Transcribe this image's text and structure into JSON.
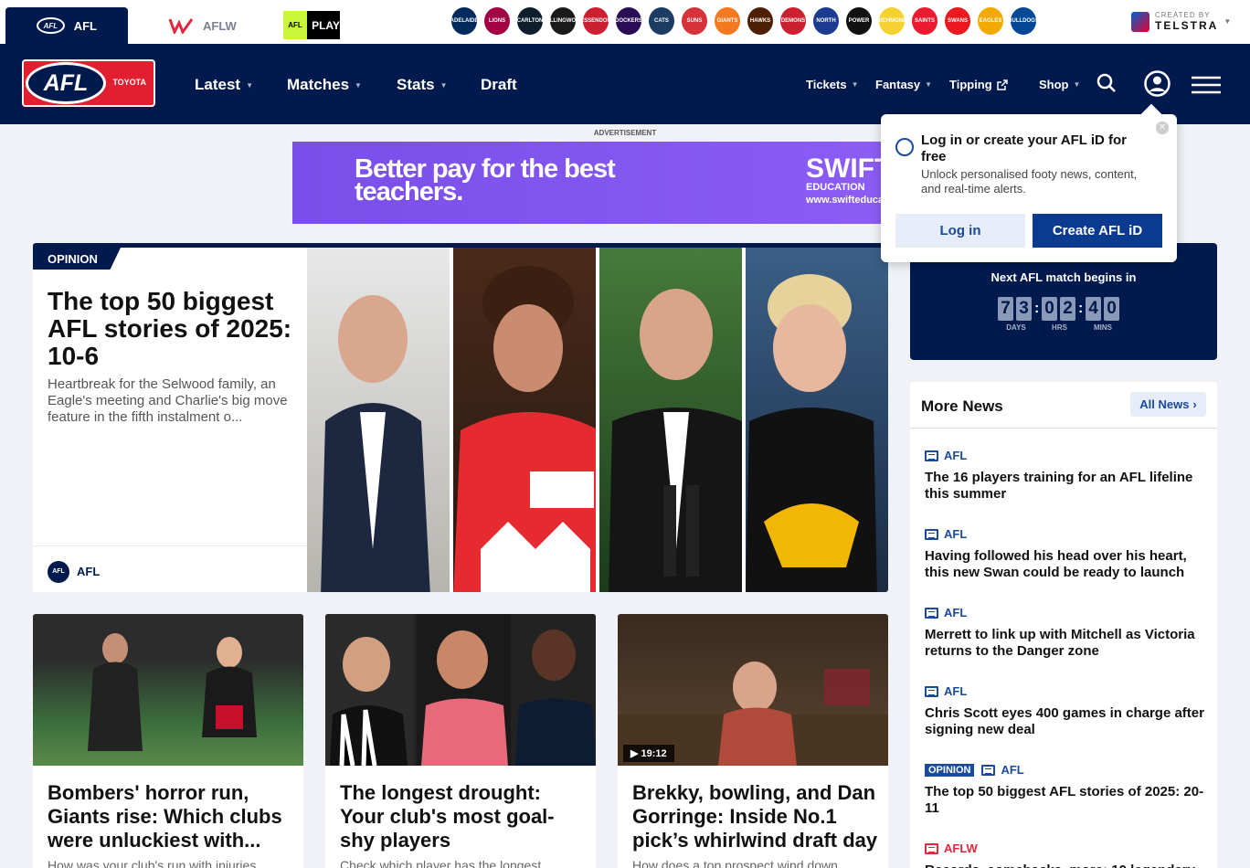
{
  "top_tabs": {
    "afl": "AFL",
    "aflw": "AFLW",
    "afl_mini": "AFL",
    "play": "PLAY"
  },
  "clubs": [
    {
      "name": "ADELAIDE",
      "color": "#002b5c"
    },
    {
      "name": "LIONS",
      "color": "#a30046"
    },
    {
      "name": "CARLTON",
      "color": "#0e1e2d"
    },
    {
      "name": "COLLINGWOOD",
      "color": "#1a1a1a"
    },
    {
      "name": "ESSENDON",
      "color": "#cc2031"
    },
    {
      "name": "DOCKERS",
      "color": "#2a0d54"
    },
    {
      "name": "CATS",
      "color": "#1c3c63"
    },
    {
      "name": "SUNS",
      "color": "#d63239"
    },
    {
      "name": "GIANTS",
      "color": "#f47920"
    },
    {
      "name": "HAWKS",
      "color": "#4d2004"
    },
    {
      "name": "DEMONS",
      "color": "#cc2031"
    },
    {
      "name": "NORTH",
      "color": "#1a3b8f"
    },
    {
      "name": "POWER",
      "color": "#111111"
    },
    {
      "name": "RICHMOND",
      "color": "#f5d130"
    },
    {
      "name": "SAINTS",
      "color": "#ed1b2f"
    },
    {
      "name": "SWANS",
      "color": "#ed171f"
    },
    {
      "name": "EAGLES",
      "color": "#f2a900"
    },
    {
      "name": "BULLDOGS",
      "color": "#014896"
    }
  ],
  "telstra": {
    "created_by": "CREATED BY",
    "name": "TELSTRA"
  },
  "logo": {
    "afl": "AFL",
    "sponsor": "TOYOTA"
  },
  "nav": {
    "latest": "Latest",
    "matches": "Matches",
    "stats": "Stats",
    "draft": "Draft",
    "tickets": "Tickets",
    "fantasy": "Fantasy",
    "tipping": "Tipping",
    "shop": "Shop"
  },
  "ad": {
    "label": "ADVERTISEMENT",
    "headline": "Better pay for the best teachers.",
    "brand": "SWIFT",
    "brand_sub": "EDUCATION",
    "url": "www.swifteducat"
  },
  "hero": {
    "badge": "OPINION",
    "title": "The top 50 biggest AFL stories of 2025: 10-6",
    "summary": "Heartbreak for the Selwood family, an Eagle's meeting and Charlie's big move feature in the fifth instalment o...",
    "source": "AFL",
    "source_logo": "AFL"
  },
  "cards": [
    {
      "title": "Bombers' horror run, Giants rise: Which clubs were unluckiest with...",
      "desc": "How was your club's run with injuries",
      "video": ""
    },
    {
      "title": "The longest drought: Your club's most goal-shy players",
      "desc": "Check which player has the longest",
      "video": ""
    },
    {
      "title": "Brekky, bowling, and Dan Gorringe: Inside No.1 pick’s whirlwind draft day",
      "desc": "How does a top prospect wind down",
      "video": "19:12"
    }
  ],
  "popup": {
    "title": "Log in or create your AFL iD for free",
    "subtitle": "Unlock personalised footy news, content, and real-time alerts.",
    "login": "Log in",
    "create": "Create AFL iD"
  },
  "countdown": {
    "label": "Next AFL match begins in",
    "d1": "7",
    "d2": "3",
    "h1": "0",
    "h2": "2",
    "m1": "4",
    "m2": "0",
    "sep": ":",
    "days": "DAYS",
    "hrs": "HRS",
    "mins": "MINS"
  },
  "more_news": {
    "title": "More News",
    "all": "All News",
    "items": [
      {
        "opinion": "",
        "tag": "AFL",
        "text": "The 16 players training for an AFL lifeline this summer"
      },
      {
        "opinion": "",
        "tag": "AFL",
        "text": "Having followed his head over his heart, this new Swan could be ready to launch"
      },
      {
        "opinion": "",
        "tag": "AFL",
        "text": "Merrett to link up with Mitchell as Victoria returns to the Danger zone"
      },
      {
        "opinion": "",
        "tag": "AFL",
        "text": "Chris Scott eyes 400 games in charge after signing new deal"
      },
      {
        "opinion": "OPINION",
        "tag": "AFL",
        "text": "The top 50 biggest AFL stories of 2025: 20-11"
      },
      {
        "opinion": "",
        "tag": "AFLW",
        "text": "Records, comebacks, more: 10 legendary"
      }
    ]
  }
}
